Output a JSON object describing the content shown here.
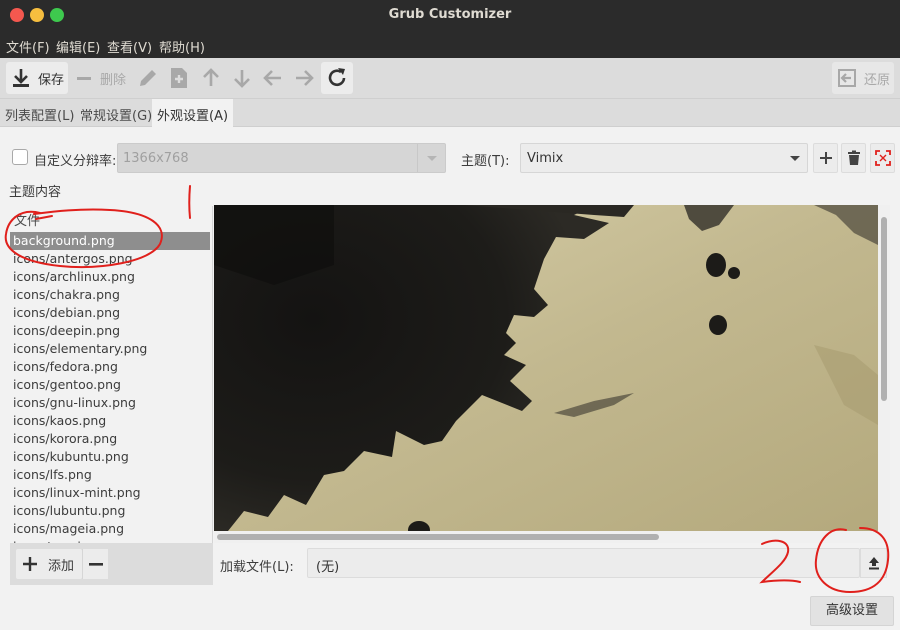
{
  "window": {
    "title": "Grub Customizer"
  },
  "menu": [
    "文件(F)",
    "编辑(E)",
    "查看(V)",
    "帮助(H)"
  ],
  "toolbar": {
    "save": "保存",
    "remove": "删除",
    "revert": "还原"
  },
  "tabs": [
    "列表配置(L)",
    "常规设置(G)",
    "外观设置(A)"
  ],
  "appearance": {
    "custom_resolution_label": "自定义分辩率:",
    "resolution_value": "1366x768",
    "theme_label": "主题(T):",
    "theme_value": "Vimix",
    "theme_content_label": "主题内容",
    "files_header": "文件",
    "files": [
      "background.png",
      "icons/antergos.png",
      "icons/archlinux.png",
      "icons/chakra.png",
      "icons/debian.png",
      "icons/deepin.png",
      "icons/elementary.png",
      "icons/fedora.png",
      "icons/gentoo.png",
      "icons/gnu-linux.png",
      "icons/kaos.png",
      "icons/korora.png",
      "icons/kubuntu.png",
      "icons/lfs.png",
      "icons/linux-mint.png",
      "icons/lubuntu.png",
      "icons/mageia.png",
      "icons/manjaro.png"
    ],
    "selected_file_index": 0,
    "add_label": "添加",
    "load_file_label": "加载文件(L):",
    "load_file_value": "(无)",
    "advanced_button": "高级设置"
  },
  "colors": {
    "titlebar": "#2b2b2b",
    "close": "#f4584f",
    "minimize": "#f6be3f",
    "maximize": "#3ec94e",
    "annotation": "#e0201c"
  },
  "annotations": {
    "mark_1": "1",
    "mark_2": "2"
  }
}
